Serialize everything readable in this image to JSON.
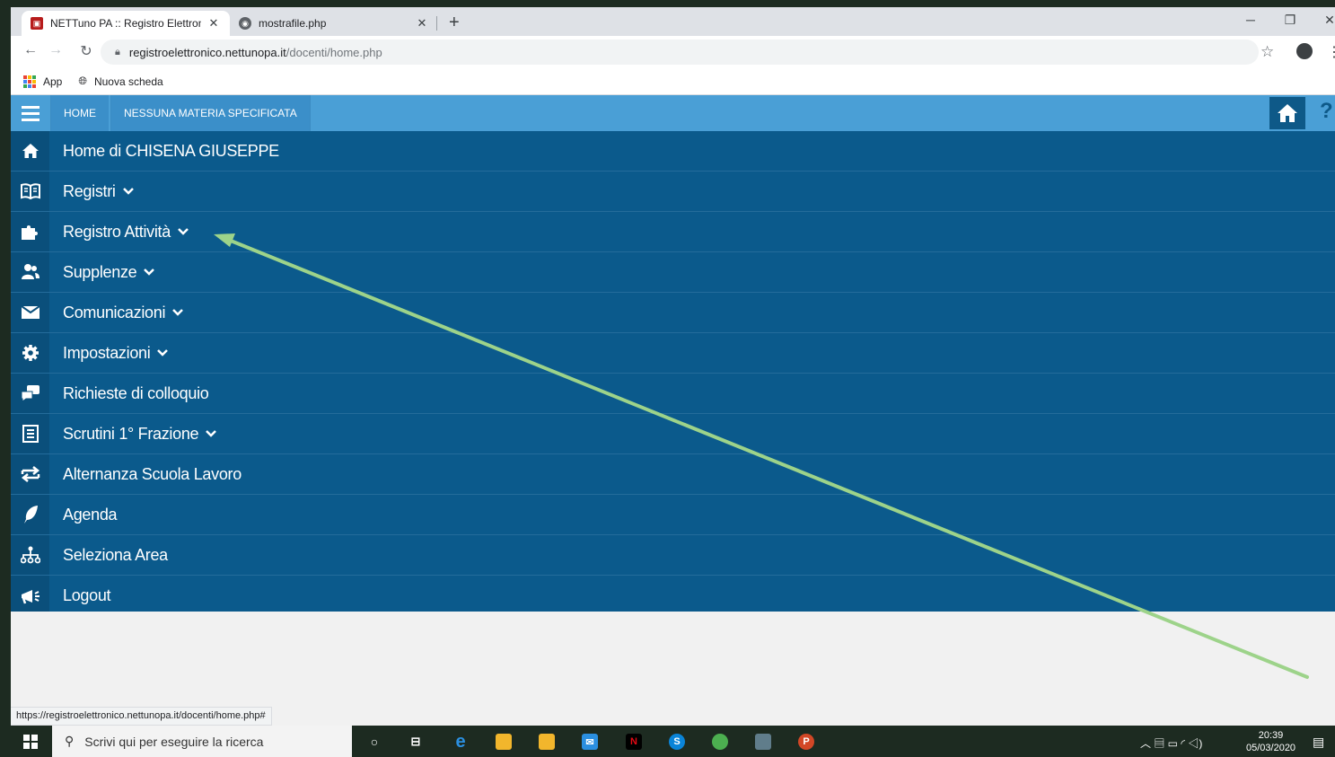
{
  "browser": {
    "tabs": [
      {
        "title": "NETTuno PA :: Registro Elettronic",
        "close": "✕",
        "active": true
      },
      {
        "title": "mostrafile.php",
        "close": "✕",
        "active": false
      }
    ],
    "new_tab": "+",
    "url_host": "registroelettronico.nettunopa.it",
    "url_path": "/docenti/home.php",
    "bookmarks": [
      {
        "label": "App"
      },
      {
        "label": "Nuova scheda"
      }
    ],
    "status_url": "https://registroelettronico.nettunopa.it/docenti/home.php#"
  },
  "topnav": {
    "items": [
      {
        "label": "HOME"
      },
      {
        "label": "NESSUNA MATERIA SPECIFICATA"
      }
    ],
    "help": "?"
  },
  "menu": {
    "items": [
      {
        "label": "Home di CHISENA GIUSEPPE",
        "icon": "home-icon",
        "dropdown": false
      },
      {
        "label": "Registri",
        "icon": "book-icon",
        "dropdown": true
      },
      {
        "label": "Registro Attività",
        "icon": "puzzle-icon",
        "dropdown": true
      },
      {
        "label": "Supplenze",
        "icon": "users-icon",
        "dropdown": true
      },
      {
        "label": "Comunicazioni",
        "icon": "envelope-icon",
        "dropdown": true
      },
      {
        "label": "Impostazioni",
        "icon": "gear-icon",
        "dropdown": true
      },
      {
        "label": "Richieste di colloquio",
        "icon": "chat-icon",
        "dropdown": false
      },
      {
        "label": "Scrutini 1° Frazione",
        "icon": "list-icon",
        "dropdown": true
      },
      {
        "label": "Alternanza Scuola Lavoro",
        "icon": "exchange-icon",
        "dropdown": false
      },
      {
        "label": "Agenda",
        "icon": "feather-icon",
        "dropdown": false
      },
      {
        "label": "Seleziona Area",
        "icon": "sitemap-icon",
        "dropdown": false
      },
      {
        "label": "Logout",
        "icon": "bullhorn-icon",
        "dropdown": false
      }
    ]
  },
  "annotation": {
    "color": "#9dd38a"
  },
  "taskbar": {
    "search_placeholder": "Scrivi qui per eseguire la ricerca",
    "time": "20:39",
    "date": "05/03/2020"
  },
  "colors": {
    "menu_bg": "#0b5a8c",
    "icon_column": "#0a4f7b",
    "topnav_bg": "#4a9fd6",
    "page_bg": "#f1f1f1"
  }
}
